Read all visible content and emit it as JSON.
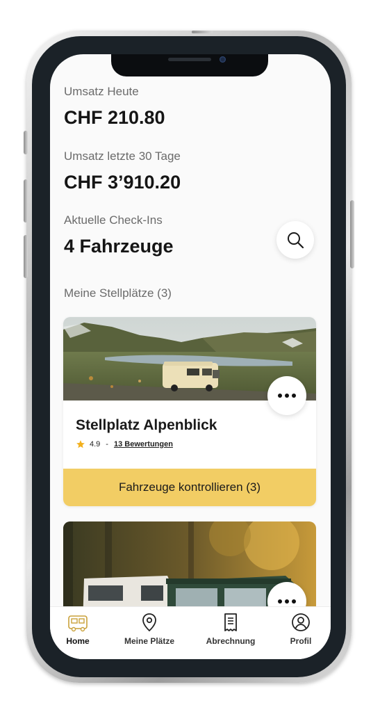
{
  "stats": {
    "today_label": "Umsatz Heute",
    "today_value": "CHF 210.80",
    "last30_label": "Umsatz letzte 30 Tage",
    "last30_value": "CHF 3’910.20",
    "checkins_label": "Aktuelle Check-Ins",
    "checkins_value": "4 Fahrzeuge"
  },
  "section": {
    "title": "Meine Stellplätze (3)"
  },
  "places": [
    {
      "title": "Stellplatz Alpenblick",
      "rating": "4.9",
      "separator": "-",
      "reviews": "13 Bewertungen",
      "cta": "Fahrzeuge kontrollieren (3)"
    }
  ],
  "tabbar": {
    "items": [
      {
        "label": "Home",
        "icon": "camper-icon",
        "active": true
      },
      {
        "label": "Meine Plätze",
        "icon": "location-pin-icon",
        "active": false
      },
      {
        "label": "Abrechnung",
        "icon": "receipt-icon",
        "active": false
      },
      {
        "label": "Profil",
        "icon": "user-icon",
        "active": false
      }
    ]
  },
  "colors": {
    "accent": "#f2cd64",
    "star": "#f2b01e",
    "background": "#fafafa"
  }
}
